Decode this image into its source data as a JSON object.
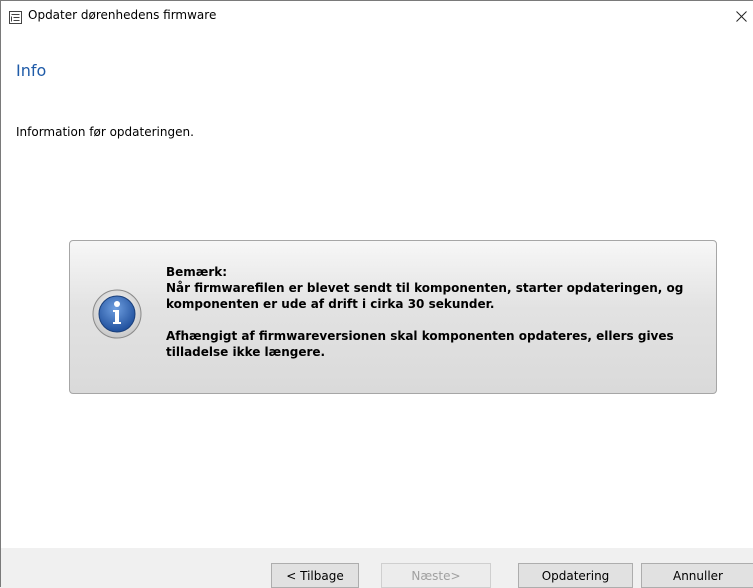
{
  "window": {
    "title": "Opdater dørenhedens firmware",
    "app_icon": "document-list-icon",
    "close_symbol": "✕"
  },
  "page": {
    "heading": "Info",
    "subtitle": "Information før opdateringen."
  },
  "notice": {
    "icon": "info-icon",
    "label": "Bemærk:",
    "line1": " Når firmwarefilen er blevet sendt til komponenten, starter opdateringen, og",
    "line2": "komponenten er ude af drift i cirka 30 sekunder.",
    "line3": " Afhængigt af firmwareversionen skal komponenten opdateres, ellers gives",
    "line4": "tilladelse ikke længere."
  },
  "buttons": {
    "back": "< Tilbage",
    "next": "Næste>",
    "update": "Opdatering",
    "cancel": "Annuller"
  },
  "colors": {
    "heading": "#1f5ba8",
    "info_icon_fill": "#2a5ea8"
  }
}
